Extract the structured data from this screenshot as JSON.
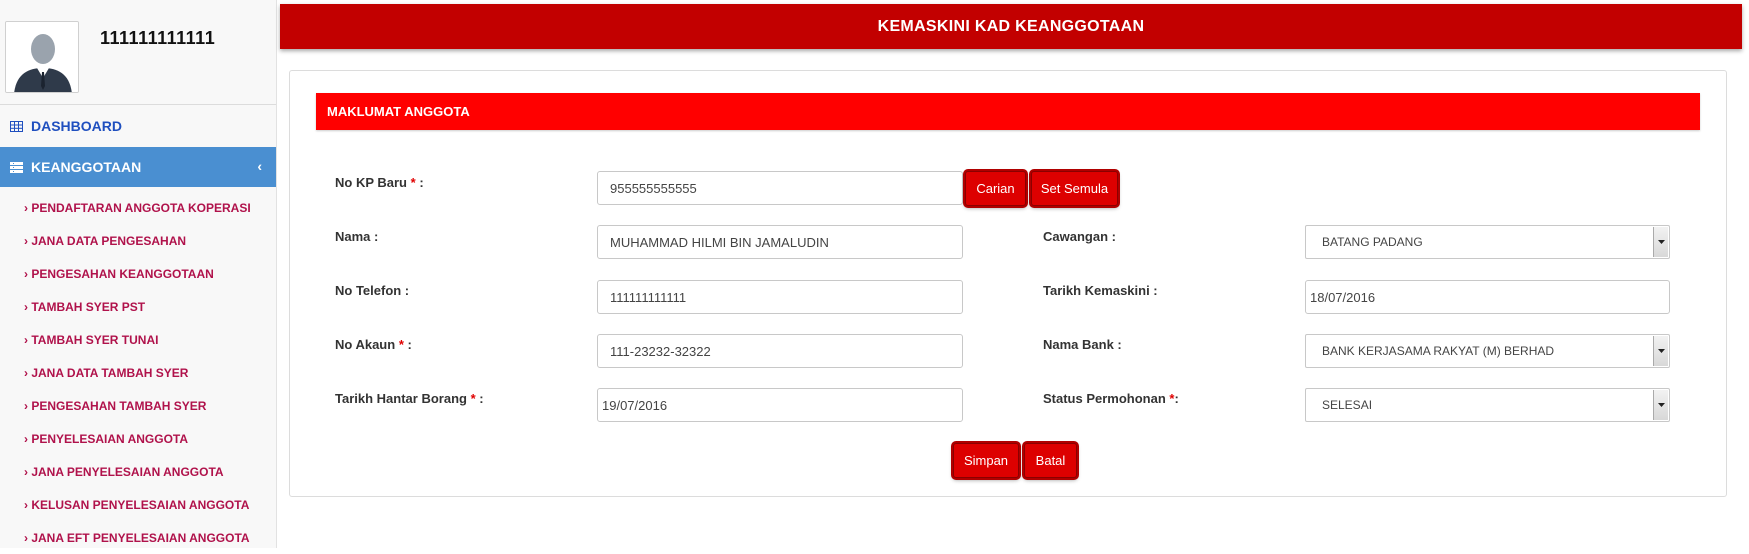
{
  "sidebar": {
    "username": "111111111111",
    "dashboard_label": "DASHBOARD",
    "section_label": "KEANGGOTAAN",
    "items": [
      "PENDAFTARAN ANGGOTA KOPERASI",
      "JANA DATA PENGESAHAN",
      "PENGESAHAN KEANGGOTAAN",
      "TAMBAH SYER PST",
      "TAMBAH SYER TUNAI",
      "JANA DATA TAMBAH SYER",
      "PENGESAHAN TAMBAH SYER",
      "PENYELESAIAN ANGGOTA",
      "JANA PENYELESAIAN ANGGOTA",
      "KELUSAN PENYELESAIAN ANGGOTA",
      "JANA EFT PENYELESAIAN ANGGOTA"
    ]
  },
  "header": {
    "title": "KEMASKINI KAD KEANGGOTAAN"
  },
  "panel": {
    "title": "MAKLUMAT ANGGOTA"
  },
  "form": {
    "no_kp": {
      "label": "No KP Baru",
      "value": "955555555555"
    },
    "nama": {
      "label": "Nama :",
      "value": "MUHAMMAD HILMI BIN JAMALUDIN"
    },
    "no_telefon": {
      "label": "No Telefon :",
      "value": "111111111111"
    },
    "no_akaun": {
      "label": "No Akaun",
      "value": "111-23232-32322"
    },
    "tarikh_hantar": {
      "label": "Tarikh Hantar Borang",
      "value": "19/07/2016"
    },
    "cawangan": {
      "label": "Cawangan :",
      "value": "BATANG PADANG"
    },
    "tarikh_kemaskini": {
      "label": "Tarikh Kemaskini :",
      "value": "18/07/2016"
    },
    "nama_bank": {
      "label": "Nama Bank :",
      "value": "BANK KERJASAMA RAKYAT (M) BERHAD"
    },
    "status": {
      "label": "Status Permohonan",
      "value": "SELESAI"
    },
    "required_mark": "*",
    "colon": ":"
  },
  "buttons": {
    "carian": "Carian",
    "set_semula": "Set Semula",
    "simpan": "Simpan",
    "batal": "Batal"
  },
  "colors": {
    "header_bg": "#c20000",
    "panel_head_bg": "#ff0000",
    "sidebar_active": "#4a8fd1",
    "submenu_text": "#b0124b"
  },
  "icons": {
    "avatar": "user-avatar-icon",
    "dashboard": "table-grid-icon",
    "keanggotaan": "list-icon",
    "chevron": "chevron-left-icon",
    "select_arrow": "dropdown-arrow-icon"
  }
}
